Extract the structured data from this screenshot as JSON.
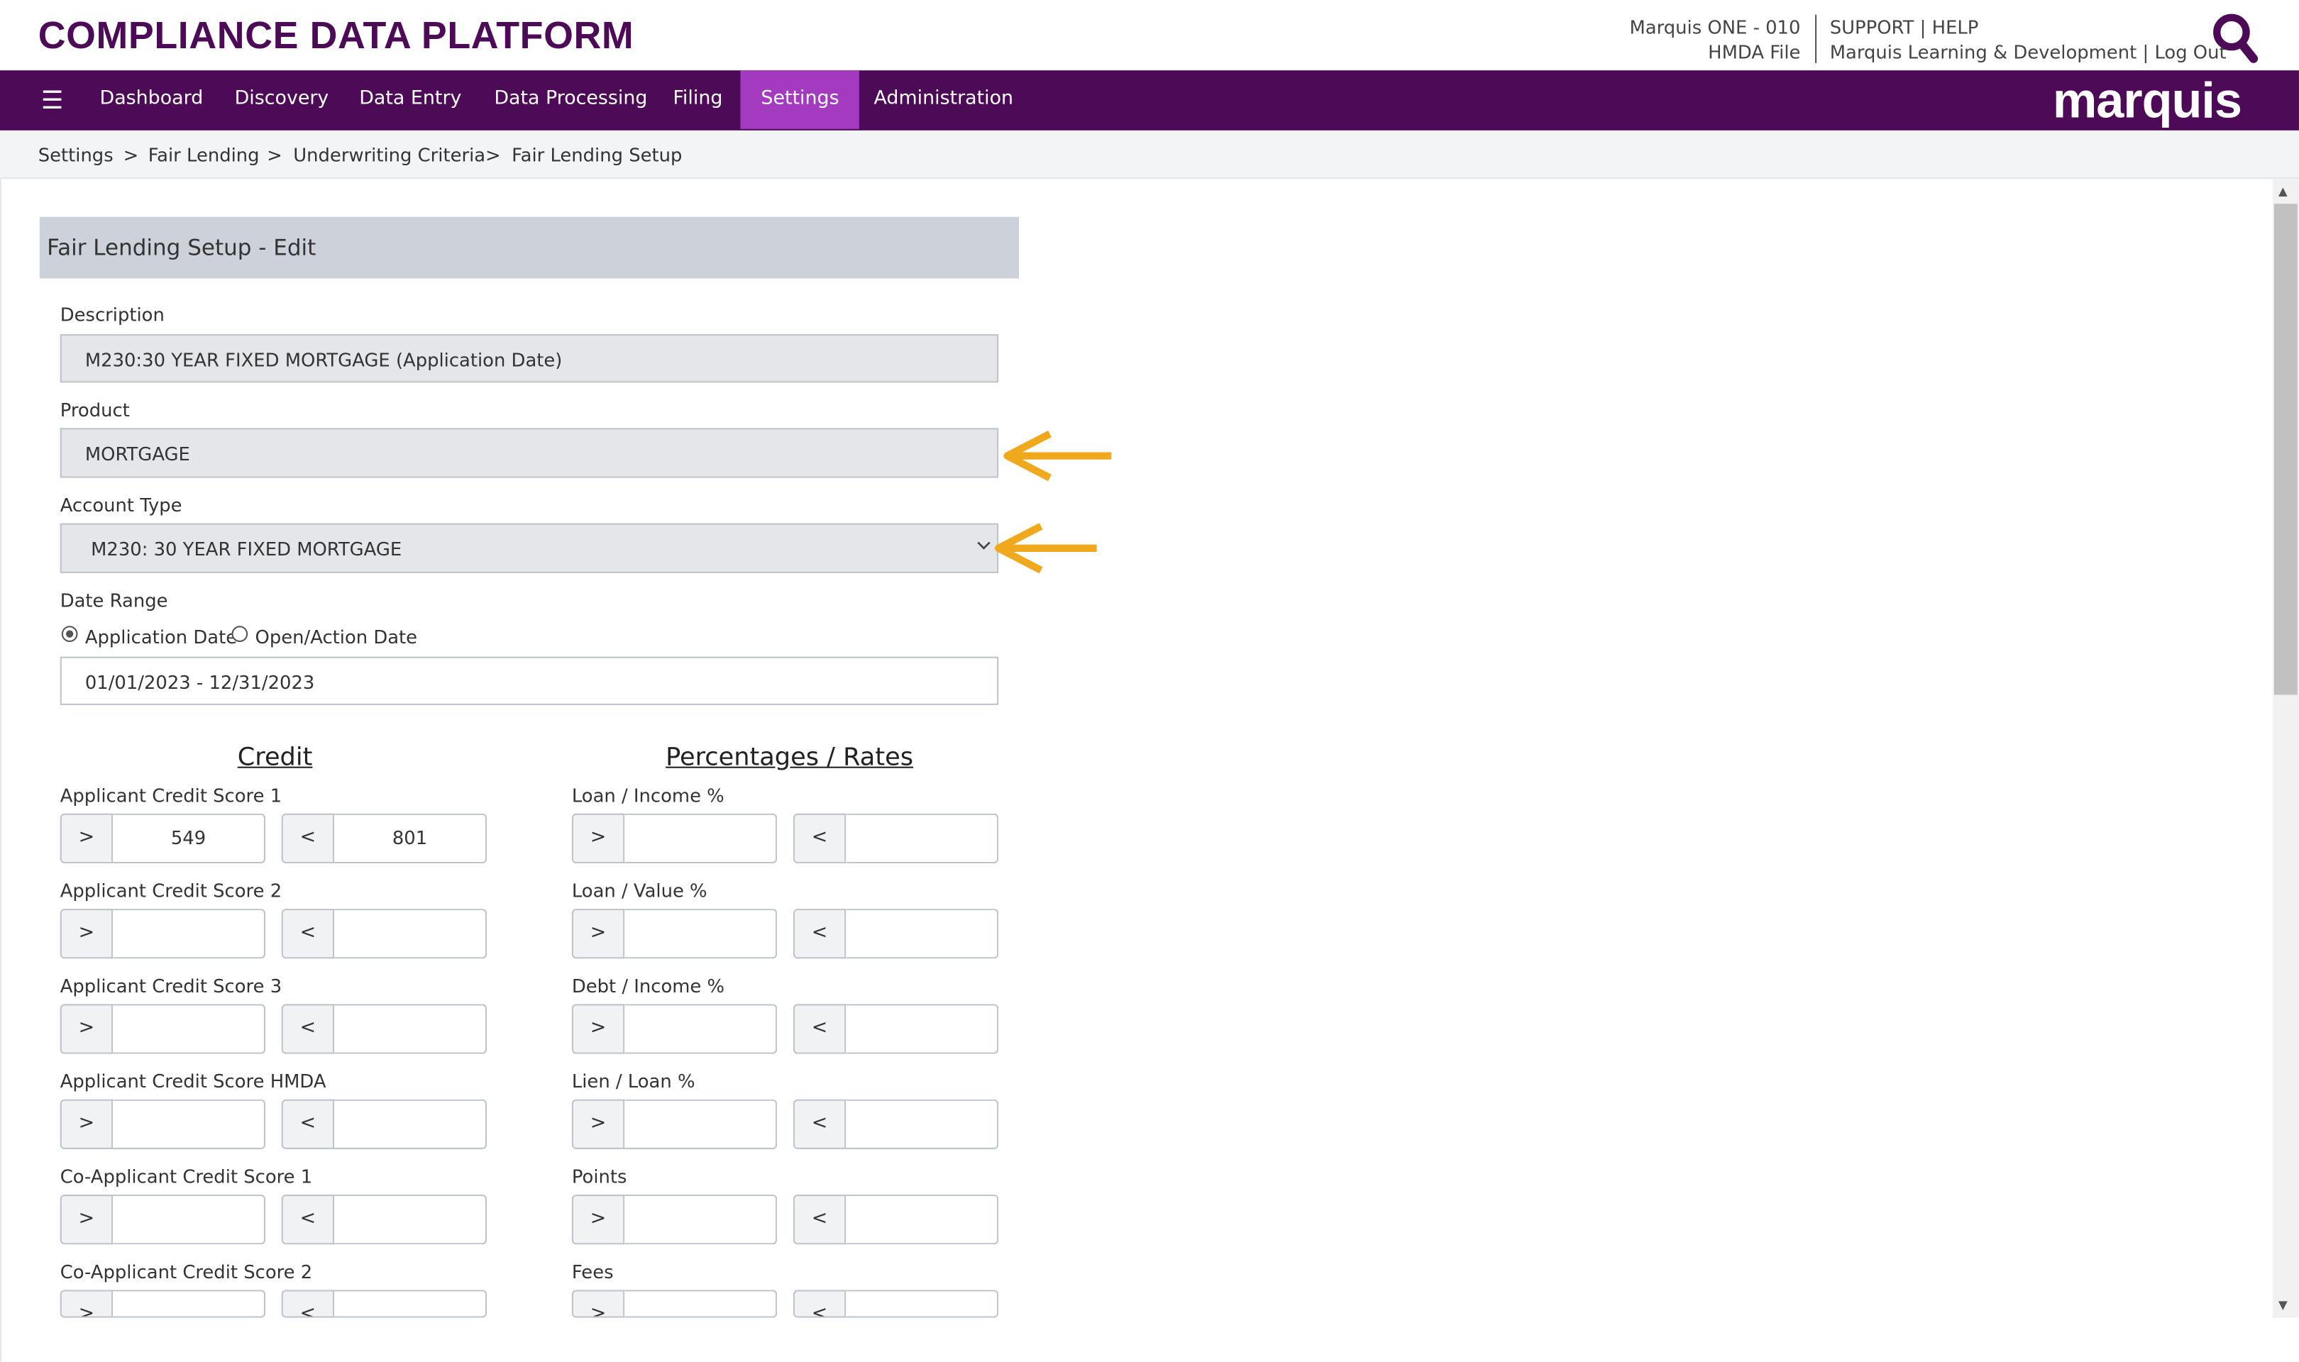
{
  "header": {
    "app_title": "COMPLIANCE DATA PLATFORM",
    "institution": "Marquis ONE - 010",
    "file": "HMDA File",
    "support": "SUPPORT",
    "help": "HELP",
    "user": "Marquis Learning & Development",
    "logout": "Log Out",
    "pipe": "|"
  },
  "nav": {
    "menu_icon": "☰",
    "items": [
      "Dashboard",
      "Discovery",
      "Data Entry",
      "Data Processing",
      "Filing",
      "Settings",
      "Administration"
    ],
    "active": "Settings",
    "logo": "marquis"
  },
  "breadcrumb": {
    "items": [
      "Settings",
      "Fair Lending",
      "Underwriting Criteria",
      "Fair Lending Setup"
    ],
    "sep": ">"
  },
  "form": {
    "title": "Fair Lending Setup - Edit",
    "description_label": "Description",
    "description_value": "M230:30 YEAR FIXED MORTGAGE (Application Date)",
    "product_label": "Product",
    "product_value": "MORTGAGE",
    "account_type_label": "Account Type",
    "account_type_value": "M230: 30 YEAR FIXED MORTGAGE",
    "date_range_label": "Date Range",
    "radio_application": "Application Date",
    "radio_open": "Open/Action Date",
    "date_range_value": "01/01/2023 - 12/31/2023",
    "gt": ">",
    "lt": "<"
  },
  "credit": {
    "title": "Credit",
    "rows": [
      {
        "label": "Applicant Credit Score 1",
        "min": "549",
        "max": "801"
      },
      {
        "label": "Applicant Credit Score 2",
        "min": "",
        "max": ""
      },
      {
        "label": "Applicant Credit Score 3",
        "min": "",
        "max": ""
      },
      {
        "label": "Applicant Credit Score HMDA",
        "min": "",
        "max": ""
      },
      {
        "label": "Co-Applicant Credit Score 1",
        "min": "",
        "max": ""
      },
      {
        "label": "Co-Applicant Credit Score 2",
        "min": "",
        "max": ""
      }
    ]
  },
  "rates": {
    "title": "Percentages / Rates",
    "rows": [
      {
        "label": "Loan / Income %",
        "min": "",
        "max": ""
      },
      {
        "label": "Loan / Value %",
        "min": "",
        "max": ""
      },
      {
        "label": "Debt / Income %",
        "min": "",
        "max": ""
      },
      {
        "label": "Lien / Loan %",
        "min": "",
        "max": ""
      },
      {
        "label": "Points",
        "min": "",
        "max": ""
      },
      {
        "label": "Fees",
        "min": "",
        "max": ""
      }
    ]
  },
  "colors": {
    "brand_purple": "#4d0a57",
    "active_tab": "#a43ac0",
    "arrow": "#f0a81c"
  }
}
